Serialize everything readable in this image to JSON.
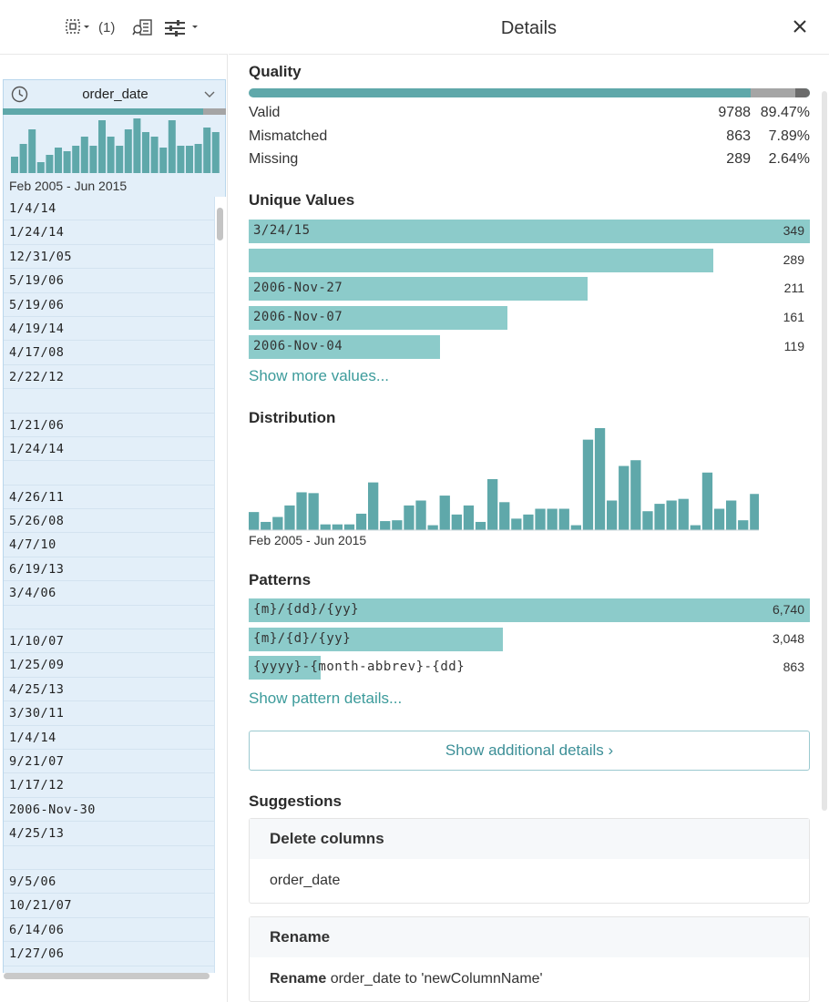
{
  "toolbar": {
    "selection_icon": "select-columns-icon",
    "selection_count": "(1)",
    "column_details_icon": "column-details-icon",
    "settings_icon": "sliders-icon"
  },
  "column": {
    "icon": "clock-icon",
    "name": "order_date",
    "range": "Feb 2005 - Jun 2015",
    "histogram": [
      18,
      32,
      48,
      12,
      20,
      28,
      24,
      30,
      40,
      30,
      58,
      40,
      30,
      48,
      60,
      45,
      40,
      28,
      58,
      30,
      30,
      32,
      50,
      45
    ],
    "rows": [
      "1/4/14",
      "1/24/14",
      "12/31/05",
      "5/19/06",
      "5/19/06",
      "4/19/14",
      "4/17/08",
      "2/22/12",
      "",
      "1/21/06",
      "1/24/14",
      "",
      "4/26/11",
      "5/26/08",
      "4/7/10",
      "6/19/13",
      "3/4/06",
      "",
      "1/10/07",
      "1/25/09",
      "4/25/13",
      "3/30/11",
      "1/4/14",
      "9/21/07",
      "1/17/12",
      "2006-Nov-30",
      "4/25/13",
      "",
      "9/5/06",
      "10/21/07",
      "6/14/06",
      "1/27/06"
    ]
  },
  "details": {
    "title": "Details",
    "close_icon": "close-icon",
    "quality": {
      "title": "Quality",
      "colors": {
        "valid": "#5fa8aa",
        "mismatched": "#a5a5a5",
        "missing": "#6b6b6b"
      },
      "fractions": {
        "valid": 0.8947,
        "mismatched": 0.0789,
        "missing": 0.0264
      },
      "rows": [
        {
          "label": "Valid",
          "count": "9788",
          "pct": "89.47%"
        },
        {
          "label": "Mismatched",
          "count": "863",
          "pct": "7.89%"
        },
        {
          "label": "Missing",
          "count": "289",
          "pct": "2.64%"
        }
      ]
    },
    "unique": {
      "title": "Unique Values",
      "items": [
        {
          "label": "3/24/15",
          "count": "349",
          "value": 349
        },
        {
          "label": "",
          "count": "289",
          "value": 289
        },
        {
          "label": "2006-Nov-27",
          "count": "211",
          "value": 211
        },
        {
          "label": "2006-Nov-07",
          "count": "161",
          "value": 161
        },
        {
          "label": "2006-Nov-04",
          "count": "119",
          "value": 119
        }
      ],
      "more_link": "Show more values..."
    },
    "distribution": {
      "title": "Distribution",
      "range": "Feb 2005 - Jun 2015"
    },
    "patterns": {
      "title": "Patterns",
      "items": [
        {
          "label": "{m}/{dd}/{yy}",
          "count": "6,740",
          "value": 6740
        },
        {
          "label": "{m}/{d}/{yy}",
          "count": "3,048",
          "value": 3048
        },
        {
          "label": "{yyyy}-{month-abbrev}-{dd}",
          "count": "863",
          "value": 863
        }
      ],
      "more_link": "Show pattern details..."
    },
    "additional_button": "Show additional details ›",
    "suggestions": {
      "title": "Suggestions",
      "cards": [
        {
          "title": "Delete columns",
          "body_prefix": "",
          "body": "order_date"
        },
        {
          "title": "Rename",
          "body_prefix": "Rename",
          "body": " order_date to 'newColumnName'"
        }
      ]
    }
  },
  "chart_data": {
    "type": "bar",
    "title": "Distribution",
    "xlabel": "Feb 2005 - Jun 2015",
    "ylabel": "",
    "color": "#5fa8aa",
    "values": [
      22,
      10,
      16,
      30,
      46,
      45,
      7,
      7,
      7,
      20,
      58,
      11,
      12,
      30,
      36,
      6,
      42,
      19,
      30,
      10,
      62,
      34,
      14,
      19,
      26,
      26,
      26,
      6,
      110,
      124,
      36,
      78,
      85,
      23,
      32,
      36,
      38,
      6,
      70,
      26,
      36,
      12,
      44,
      10
    ]
  }
}
